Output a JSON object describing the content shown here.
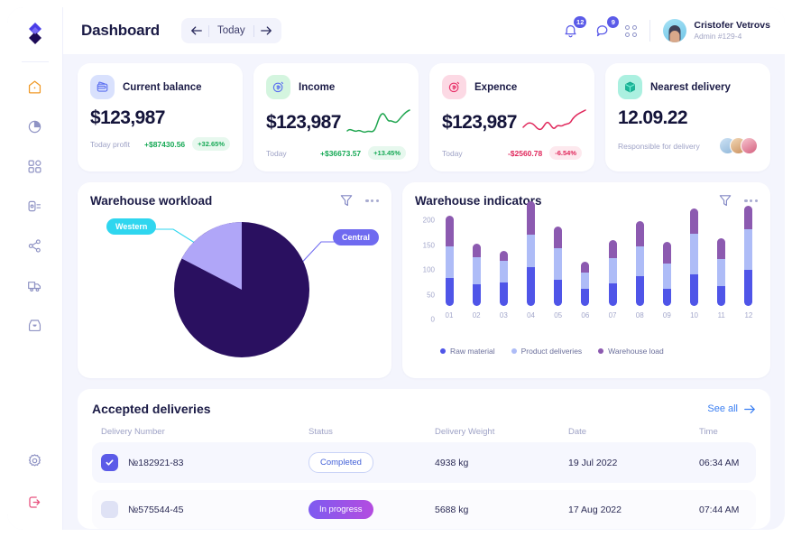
{
  "sidebar": {
    "logo_name": "app-logo",
    "items": [
      {
        "icon": "home-icon",
        "active": true
      },
      {
        "icon": "pie-chart-icon",
        "active": false
      },
      {
        "icon": "grid-icon",
        "active": false
      },
      {
        "icon": "bar-chart-icon",
        "active": false
      },
      {
        "icon": "share-network-icon",
        "active": false
      },
      {
        "icon": "truck-icon",
        "active": false
      },
      {
        "icon": "inbox-icon",
        "active": false
      }
    ],
    "bottom": [
      {
        "icon": "gear-icon"
      },
      {
        "icon": "logout-icon"
      }
    ]
  },
  "header": {
    "title": "Dashboard",
    "prev_label": "←",
    "today_label": "Today",
    "next_label": "→",
    "notifications_count": "12",
    "messages_count": "9",
    "user": {
      "name": "Cristofer Vetrovs",
      "role": "Admin #129-4"
    }
  },
  "stats": [
    {
      "label": "Current balance",
      "icon": "wallet-icon",
      "icon_bg": "#d9e1fd",
      "icon_color": "#5b6ff0",
      "value": "$123,987",
      "foot_label": "Today profit",
      "delta": "+$87430.56",
      "percent": "+32.65%",
      "direction": "up",
      "sparkline": false
    },
    {
      "label": "Income",
      "icon": "income-icon",
      "icon_bg": "#d4f5df",
      "icon_color": "#5b6ff0",
      "value": "$123,987",
      "foot_label": "Today",
      "delta": "+$36673.57",
      "percent": "+13.45%",
      "direction": "up",
      "sparkline": true,
      "spark_color": "#21a651"
    },
    {
      "label": "Expence",
      "icon": "expence-icon",
      "icon_bg": "#fcd9e4",
      "icon_color": "#e8336a",
      "value": "$123,987",
      "foot_label": "Today",
      "delta": "-$2560.78",
      "percent": "-6.54%",
      "direction": "dn",
      "sparkline": true,
      "spark_color": "#e0275b"
    },
    {
      "label": "Nearest delivery",
      "icon": "box-icon",
      "icon_bg": "#abf0e0",
      "icon_color": "#1db89a",
      "value": "12.09.22",
      "foot_label": "Responsible for delivery",
      "delta": "",
      "percent": "",
      "direction": "none",
      "sparkline": false,
      "avatars": 3
    }
  ],
  "workload": {
    "title": "Warehouse workload",
    "filter_icon": "filter-icon",
    "menu_icon": "more-options-icon",
    "chart_data": {
      "type": "pie",
      "title": "Warehouse workload",
      "categories": [
        "Central",
        "Western"
      ],
      "values": [
        81,
        19
      ],
      "colors": [
        "#2a1060",
        "#b0a6f8"
      ],
      "labels": [
        {
          "text": "Western",
          "color": "#2fd6ef"
        },
        {
          "text": "Central",
          "color": "#6f6af0"
        }
      ],
      "legend": "callout-tags"
    }
  },
  "indicators": {
    "title": "Warehouse indicators",
    "filter_icon": "filter-icon",
    "menu_icon": "more-options-icon",
    "chart_data": {
      "type": "bar",
      "title": "Warehouse indicators",
      "stacked": true,
      "categories": [
        "01",
        "02",
        "03",
        "04",
        "05",
        "06",
        "07",
        "08",
        "09",
        "10",
        "11",
        "12"
      ],
      "yticks": [
        0,
        50,
        100,
        150,
        200
      ],
      "ylim": [
        0,
        215
      ],
      "xlabel": "",
      "ylabel": "",
      "grid": false,
      "legend_position": "bottom-left",
      "series": [
        {
          "name": "Raw material",
          "color": "#4f55e8",
          "values": [
            57,
            44,
            47,
            78,
            53,
            35,
            45,
            60,
            35,
            63,
            41,
            73
          ]
        },
        {
          "name": "Product deliveries",
          "color": "#aebcf7",
          "values": [
            64,
            54,
            45,
            66,
            63,
            32,
            51,
            60,
            51,
            83,
            53,
            81
          ]
        },
        {
          "name": "Warehouse load",
          "color": "#8c5ab0",
          "values": [
            61,
            28,
            20,
            67,
            45,
            23,
            37,
            52,
            44,
            50,
            43,
            48
          ]
        }
      ],
      "legend": [
        "Raw material",
        "Product deliveries",
        "Warehouse load"
      ]
    }
  },
  "table": {
    "title": "Accepted deliveries",
    "see_all": "See all",
    "see_all_icon": "arrow-right-icon",
    "columns": [
      "Delivery Number",
      "Status",
      "Delivery Weight",
      "Date",
      "Time"
    ],
    "rows": [
      {
        "checked": true,
        "number": "№182921-83",
        "status": "Completed",
        "status_type": "completed",
        "weight": "4938 kg",
        "date": "19 Jul 2022",
        "time": "06:34 AM"
      },
      {
        "checked": false,
        "number": "№575544-45",
        "status": "In progress",
        "status_type": "progress",
        "weight": "5688 kg",
        "date": "17 Aug 2022",
        "time": "07:44 AM"
      }
    ]
  }
}
